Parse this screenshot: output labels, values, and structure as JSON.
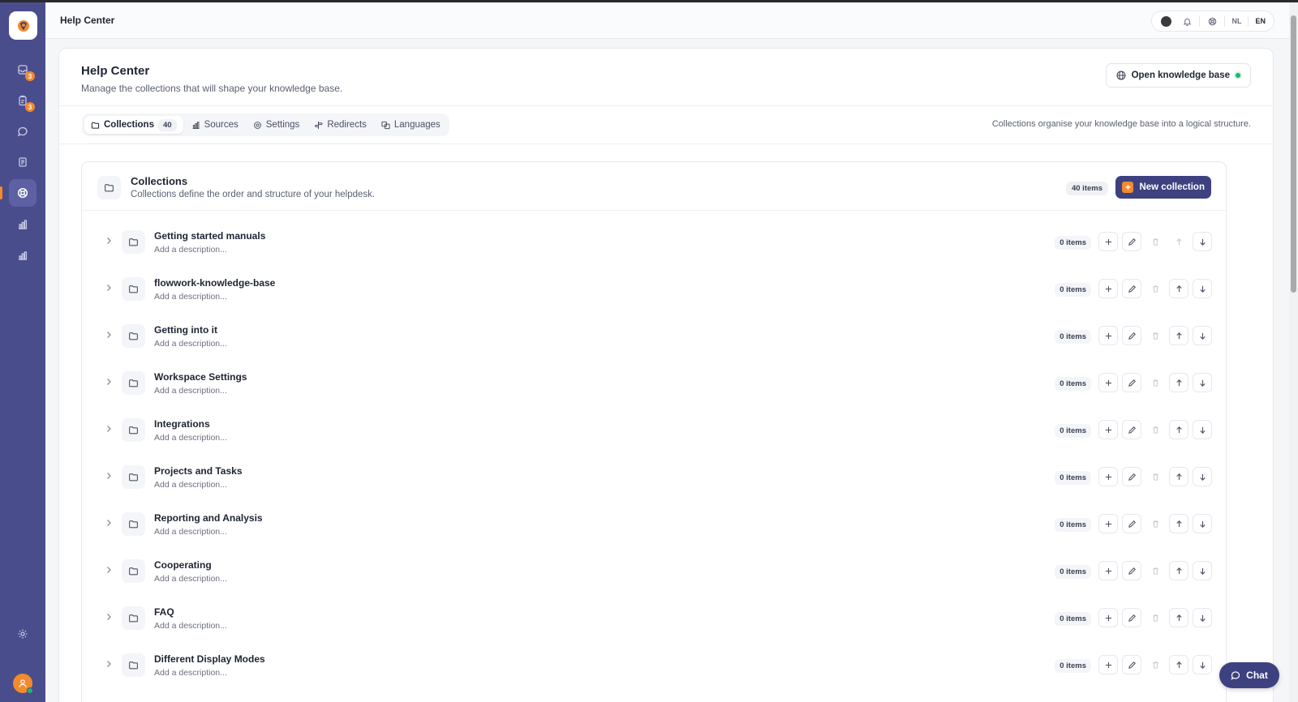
{
  "app": {
    "title": "Help Center"
  },
  "sidebar": {
    "items": [
      {
        "icon": "inbox-icon",
        "badge": "3"
      },
      {
        "icon": "clipboard-icon",
        "badge": "3"
      },
      {
        "icon": "chat-bubble-icon",
        "badge": ""
      },
      {
        "icon": "document-icon",
        "badge": ""
      },
      {
        "icon": "lifebuoy-icon",
        "badge": "",
        "active": true
      },
      {
        "icon": "bar-chart-icon",
        "badge": ""
      },
      {
        "icon": "analytics-icon",
        "badge": ""
      }
    ],
    "settings_icon": "gear-icon",
    "avatar_icon": "user-icon"
  },
  "topbar": {
    "title": "Help Center",
    "languages": [
      "NL",
      "EN"
    ],
    "active_language": "EN"
  },
  "header": {
    "title": "Help Center",
    "subtitle": "Manage the collections that will shape your knowledge base.",
    "open_kb_label": "Open knowledge base"
  },
  "tabs": [
    {
      "label": "Collections",
      "count": "40",
      "icon": "folder-icon",
      "active": true
    },
    {
      "label": "Sources",
      "icon": "bar-chart-icon"
    },
    {
      "label": "Settings",
      "icon": "gear-icon"
    },
    {
      "label": "Redirects",
      "icon": "signpost-icon"
    },
    {
      "label": "Languages",
      "icon": "translate-icon"
    }
  ],
  "tabs_hint": "Collections organise your knowledge base into a logical structure.",
  "collections_panel": {
    "title": "Collections",
    "subtitle": "Collections define the order and structure of your helpdesk.",
    "count_label": "40 items",
    "new_button_label": "New collection",
    "rows": [
      {
        "title": "Getting started manuals",
        "description": "Add a description...",
        "count": "0 items",
        "first": true
      },
      {
        "title": "flowwork-knowledge-base",
        "description": "Add a description...",
        "count": "0 items"
      },
      {
        "title": "Getting into it",
        "description": "Add a description...",
        "count": "0 items"
      },
      {
        "title": "Workspace Settings",
        "description": "Add a description...",
        "count": "0 items"
      },
      {
        "title": "Integrations",
        "description": "Add a description...",
        "count": "0 items"
      },
      {
        "title": "Projects and Tasks",
        "description": "Add a description...",
        "count": "0 items"
      },
      {
        "title": "Reporting and Analysis",
        "description": "Add a description...",
        "count": "0 items"
      },
      {
        "title": "Cooperating",
        "description": "Add a description...",
        "count": "0 items"
      },
      {
        "title": "FAQ",
        "description": "Add a description...",
        "count": "0 items"
      },
      {
        "title": "Different Display Modes",
        "description": "Add a description...",
        "count": "0 items"
      }
    ]
  },
  "chat": {
    "label": "Chat"
  },
  "colors": {
    "sidebar": "#4a4d8c",
    "accent": "#f28a2e",
    "primary_button": "#3d417f",
    "online": "#22b573"
  }
}
